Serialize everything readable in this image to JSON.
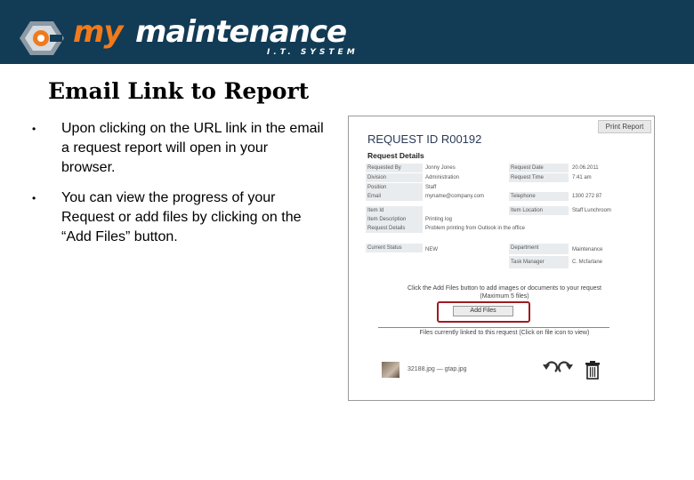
{
  "logo": {
    "my": "my",
    "main": "maintenance",
    "sub": "I.T. SYSTEM"
  },
  "slide": {
    "title": "Email Link to Report",
    "bullets": [
      "Upon clicking on the URL link in the email a request report will open in your browser.",
      "You can view the progress of your Request or add files by clicking on the “Add Files” button."
    ]
  },
  "report": {
    "print_label": "Print Report",
    "request_id": "REQUEST ID R00192",
    "details_heading": "Request Details",
    "left_labels": [
      "Requested By",
      "Division",
      "Position",
      "Email",
      "Item Id",
      "Item Description",
      "Request Details",
      "Current Status"
    ],
    "left_values": [
      "Jonny Jones",
      "Administration",
      "Staff",
      "myname@company.com",
      "",
      "Printing log",
      "Problem printing from Outlook in the office",
      "NEW"
    ],
    "right_labels": [
      "Request Date",
      "Request Time",
      "Telephone",
      "Item Location",
      "Department",
      "Task Manager"
    ],
    "right_values": [
      "20.06.2011",
      "7:41 am",
      "1300 272 87",
      "Staff Lunchroom",
      "Maintenance",
      "C. Mcfarlane"
    ],
    "add_prompt": "Click the Add Files button to add images or documents to your request",
    "add_max": "(Maximum 5 files)",
    "add_button": "Add Files",
    "linked_text": "Files currently linked to this request (Click on file icon to view)",
    "file_name": "32188.jpg — gtap.jpg"
  },
  "colors": {
    "banner": "#123b55",
    "accent": "#f07a1c",
    "highlight": "#9e1b22"
  }
}
